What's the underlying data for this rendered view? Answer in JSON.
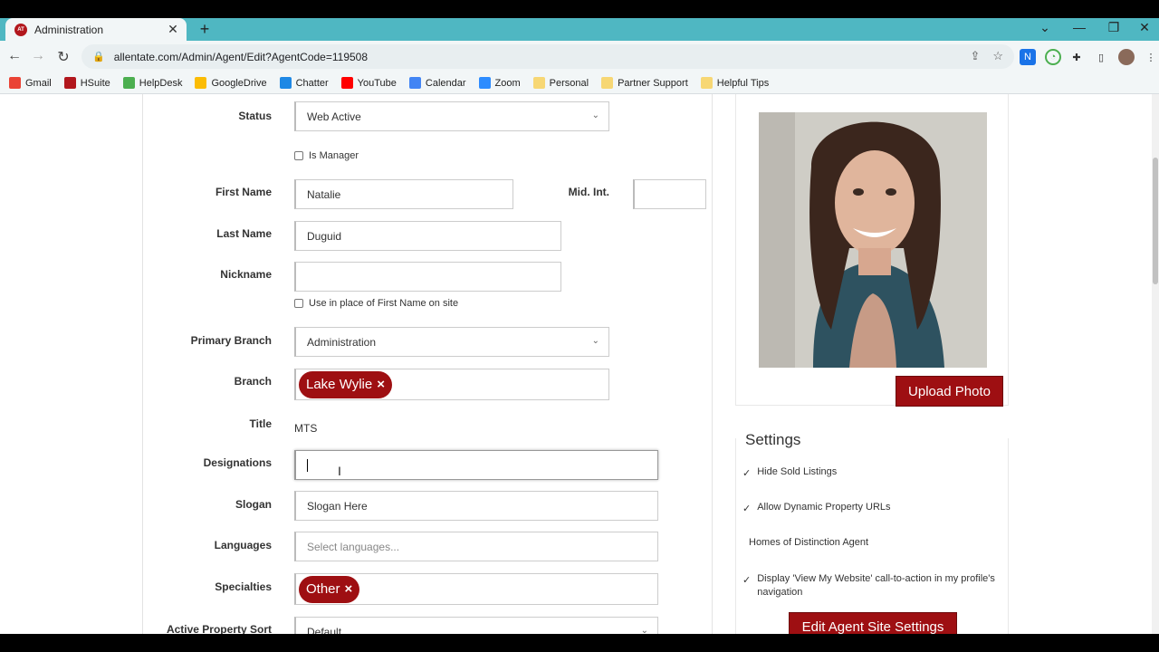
{
  "browser": {
    "tab_title": "Administration",
    "url": "allentate.com/Admin/Agent/Edit?AgentCode=119508",
    "bookmarks": [
      {
        "label": "Gmail",
        "color": "#ea4335"
      },
      {
        "label": "HSuite",
        "color": "#b2171d"
      },
      {
        "label": "HelpDesk",
        "color": "#4caf50"
      },
      {
        "label": "GoogleDrive",
        "color": "#fbbc04"
      },
      {
        "label": "Chatter",
        "color": "#1e88e5"
      },
      {
        "label": "YouTube",
        "color": "#ff0000"
      },
      {
        "label": "Calendar",
        "color": "#4285f4"
      },
      {
        "label": "Zoom",
        "color": "#2d8cff"
      },
      {
        "label": "Personal",
        "color": "#f7d774"
      },
      {
        "label": "Partner Support",
        "color": "#f7d774"
      },
      {
        "label": "Helpful Tips",
        "color": "#f7d774"
      }
    ]
  },
  "form": {
    "status_label": "Status",
    "status_value": "Web Active",
    "is_manager_label": "Is Manager",
    "first_name_label": "First Name",
    "first_name_value": "Natalie",
    "mid_int_label": "Mid. Int.",
    "mid_int_value": "",
    "last_name_label": "Last Name",
    "last_name_value": "Duguid",
    "nickname_label": "Nickname",
    "nickname_value": "",
    "use_in_place_label": "Use in place of First Name on site",
    "primary_branch_label": "Primary Branch",
    "primary_branch_value": "Administration",
    "branch_label": "Branch",
    "branch_tag": "Lake Wylie",
    "title_label": "Title",
    "title_value": "MTS",
    "designations_label": "Designations",
    "designations_value": "",
    "slogan_label": "Slogan",
    "slogan_value": "Slogan Here",
    "languages_label": "Languages",
    "languages_placeholder": "Select languages...",
    "specialties_label": "Specialties",
    "specialties_tag": "Other",
    "sort_order_label": "Active Property Sort Order",
    "sort_order_value": "Default"
  },
  "sidebar": {
    "upload_photo_label": "Upload Photo",
    "settings_title": "Settings",
    "settings": [
      {
        "label": "Hide Sold Listings",
        "checked": true
      },
      {
        "label": "Allow Dynamic Property URLs",
        "checked": true
      },
      {
        "label": "Homes of Distinction Agent",
        "checked": false
      },
      {
        "label": "Display 'View My Website' call-to-action in my profile's navigation",
        "checked": true
      }
    ],
    "edit_site_settings_label": "Edit Agent Site Settings"
  },
  "colors": {
    "accent": "#9e0f12",
    "chrome": "#4fb7c2"
  }
}
